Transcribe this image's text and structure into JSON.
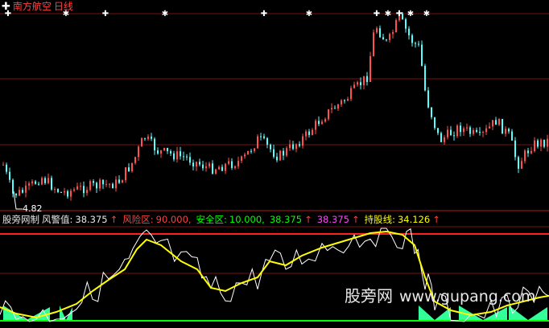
{
  "window": {
    "icon": "indicator-plus-icon",
    "stock_name": "南方航空",
    "period": "日线"
  },
  "price_chart": {
    "low_marker": "4.82",
    "signal_icon": "cross-star-icon",
    "colors": {
      "up": "#ff5050",
      "down": "#54ffff",
      "marker": "#ffffff"
    }
  },
  "indicator": {
    "name": "股旁网制",
    "items": [
      {
        "label": "风警值:",
        "value": "38.375",
        "arrow": "↑",
        "color": "#e8e8e8"
      },
      {
        "label": "风险区:",
        "value": "90.000,",
        "color": "#ff4040"
      },
      {
        "label": "安全区:",
        "value": "10.000,",
        "color": "#00ff00"
      },
      {
        "label": "",
        "value": "38.375",
        "arrow": "↑",
        "color": "#00ff00"
      },
      {
        "label": "",
        "value": "38.375",
        "arrow": "↑",
        "color": "#ff44ff"
      },
      {
        "label": "持股线:",
        "value": "34.126",
        "arrow": "↑",
        "color": "#ffff00"
      }
    ],
    "lines": {
      "risk": "#ff2020",
      "safe": "#00ff00",
      "hold": "#ffff00",
      "raw": "#ffffff",
      "fill": "#33ff99"
    }
  },
  "watermark": {
    "site": "股旁网",
    "url": "www.gupang.com"
  }
}
